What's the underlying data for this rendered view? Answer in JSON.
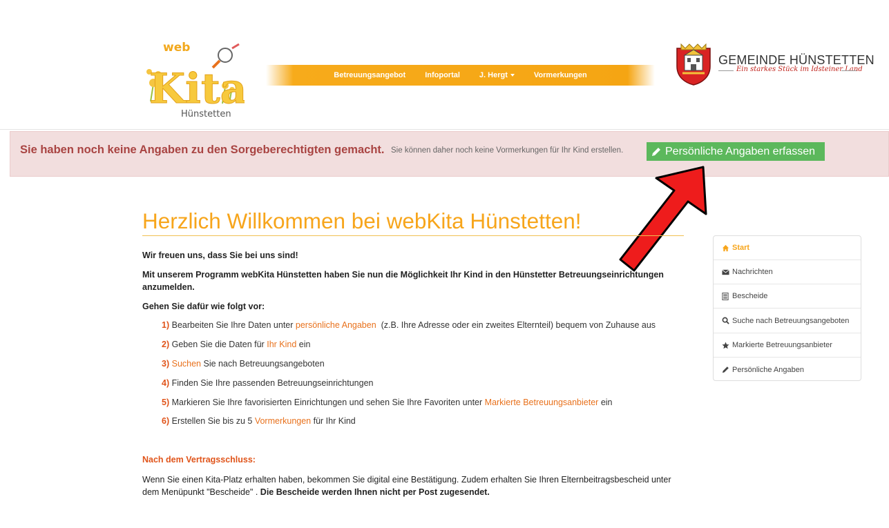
{
  "header": {
    "logo": {
      "top_text": "web",
      "main_text": "Kita",
      "sub_text": "Hünstetten"
    },
    "nav": [
      {
        "label": "Betreuungsangebot"
      },
      {
        "label": "Infoportal"
      },
      {
        "label": "J. Hergt",
        "dropdown": true
      },
      {
        "label": "Vormerkungen"
      }
    ],
    "gemeinde": {
      "name": "GEMEINDE HÜNSTETTEN",
      "slogan": "Ein starkes Stück im Idsteiner Land"
    }
  },
  "alert": {
    "strong": "Sie haben noch keine Angaben zu den Sorgeberechtigten gemacht.",
    "text": "Sie können daher noch keine Vormerkungen für Ihr Kind erstellen.",
    "button_label": "Persönliche Angaben erfassen",
    "button_icon": "pencil-icon"
  },
  "main": {
    "title": "Herzlich Willkommen bei webKita Hünstetten!",
    "intro1": "Wir freuen uns, dass Sie bei uns sind!",
    "intro2": "Mit unserem Programm webKita Hünstetten haben Sie nun die Möglichkeit Ihr Kind in den Hünstetter Betreuungseinrichtungen anzumelden.",
    "intro3": "Gehen Sie dafür wie folgt vor:",
    "steps": {
      "s1": {
        "num": "1)",
        "pre": "Bearbeiten Sie Ihre Daten unter",
        "link": "persönliche Angaben",
        "post": "(z.B. Ihre Adresse oder ein zweites Elternteil) bequem von Zuhause aus"
      },
      "s2": {
        "num": "2)",
        "pre": "Geben Sie die Daten für",
        "link": "Ihr Kind",
        "post": "ein"
      },
      "s3": {
        "num": "3)",
        "link": "Suchen",
        "post": "Sie nach Betreuungsangeboten"
      },
      "s4": {
        "num": "4)",
        "text": "Finden Sie Ihre passenden Betreuungseinrichtungen"
      },
      "s5": {
        "num": "5)",
        "pre": "Markieren Sie Ihre favorisierten Einrichtungen und sehen Sie Ihre Favoriten unter",
        "link": "Markierte Betreuungsanbieter",
        "post": "ein"
      },
      "s6": {
        "num": "6)",
        "pre": "Erstellen Sie bis zu 5",
        "link": "Vormerkungen",
        "post": "für Ihr Kind"
      }
    },
    "vertrag_heading": "Nach dem Vertragsschluss:",
    "vertrag_text": "Wenn Sie einen Kita-Platz erhalten haben, bekommen Sie digital eine Bestätigung. Zudem erhalten Sie Ihren Elternbeitragsbescheid unter dem Menüpunkt \"Bescheide\" .",
    "vertrag_bold": "Die Bescheide werden Ihnen nicht per Post zugesendet."
  },
  "sidebar": {
    "items": [
      {
        "label": "Start",
        "icon": "home-icon",
        "active": true
      },
      {
        "label": "Nachrichten",
        "icon": "envelope-icon"
      },
      {
        "label": "Bescheide",
        "icon": "document-icon"
      },
      {
        "label": "Suche nach Betreuungsangeboten",
        "icon": "search-icon"
      },
      {
        "label": "Markierte Betreuungsanbieter",
        "icon": "star-icon"
      },
      {
        "label": "Persönliche Angaben",
        "icon": "pencil-icon"
      }
    ]
  },
  "colors": {
    "accent": "#f7a51b",
    "link": "#e8711c",
    "alert_bg": "#f2dede",
    "alert_text": "#a94442",
    "button_green": "#5cb85c",
    "arrow_red": "#ee1c1c"
  }
}
